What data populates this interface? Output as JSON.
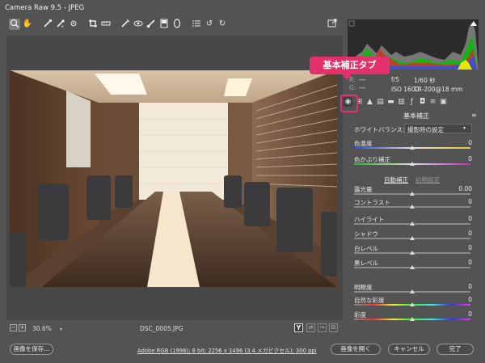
{
  "window": {
    "title": "Camera Raw 9.5  -  JPEG"
  },
  "toolbar": {
    "icons": [
      "zoom-icon",
      "hand-icon",
      "white-balance-icon",
      "color-sampler-icon",
      "targeted-adjustment-icon",
      "crop-icon",
      "straighten-icon",
      "spot-removal-icon",
      "red-eye-icon",
      "adjustment-brush-icon",
      "graduated-filter-icon",
      "radial-filter-icon",
      "preferences-icon",
      "rotate-ccw-icon",
      "rotate-cw-icon"
    ],
    "fullscreen_icon": "fullscreen-icon"
  },
  "status": {
    "zoom": "30.6%",
    "filename": "DSC_0005.JPG",
    "compare_label": "Y"
  },
  "exif": {
    "aperture": "f/5",
    "shutter": "1/60 秒",
    "iso": "ISO 1600",
    "lens": "18-200@18 mm",
    "r": "---",
    "g": "---",
    "b": "---"
  },
  "callout": {
    "text": "基本補正タブ"
  },
  "panel": {
    "title": "基本補正",
    "wb_label": "ホワイトバランス：",
    "wb_value": "撮影時の設定",
    "auto_label": "自動補正",
    "default_label": "初期設定",
    "sliders": [
      {
        "label": "色温度",
        "value": "0"
      },
      {
        "label": "色かぶり補正",
        "value": "0"
      },
      {
        "label": "露光量",
        "value": "0.00"
      },
      {
        "label": "コントラスト",
        "value": "0"
      },
      {
        "label": "ハイライト",
        "value": "0"
      },
      {
        "label": "シャドウ",
        "value": "0"
      },
      {
        "label": "白レベル",
        "value": "0"
      },
      {
        "label": "黒レベル",
        "value": "0"
      },
      {
        "label": "明瞭度",
        "value": "0"
      },
      {
        "label": "自然な彩度",
        "value": "0"
      },
      {
        "label": "彩度",
        "value": "0"
      }
    ]
  },
  "footer": {
    "save_label": "画像を保存...",
    "workflow_link": "Adobe RGB (1998); 8 bit; 2256 x 1496 (3.4 メガピクセル); 300 ppi",
    "open_label": "画像を開く",
    "cancel_label": "キャンセル",
    "done_label": "完了"
  },
  "colors": {
    "accent": "#e3316b",
    "panel_bg": "#535353"
  }
}
